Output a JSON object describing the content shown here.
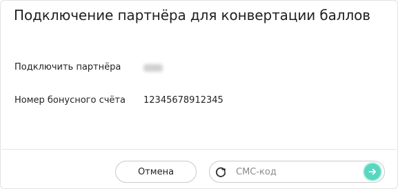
{
  "dialog": {
    "title": "Подключение партнёра для конвертации баллов"
  },
  "fields": {
    "partner_label": "Подключить партнёра",
    "partner_value": "test",
    "account_label": "Номер бонусного счёта",
    "account_value": "12345678912345"
  },
  "footer": {
    "cancel_label": "Отмена",
    "sms_placeholder": "СМС-код",
    "sms_value": ""
  },
  "icons": {
    "refresh": "refresh-icon",
    "submit": "arrow-right-icon"
  },
  "colors": {
    "accent": "#57d6c0",
    "border": "#c9c9c9",
    "text": "#1f1f1f",
    "placeholder": "#8a8a8a"
  }
}
